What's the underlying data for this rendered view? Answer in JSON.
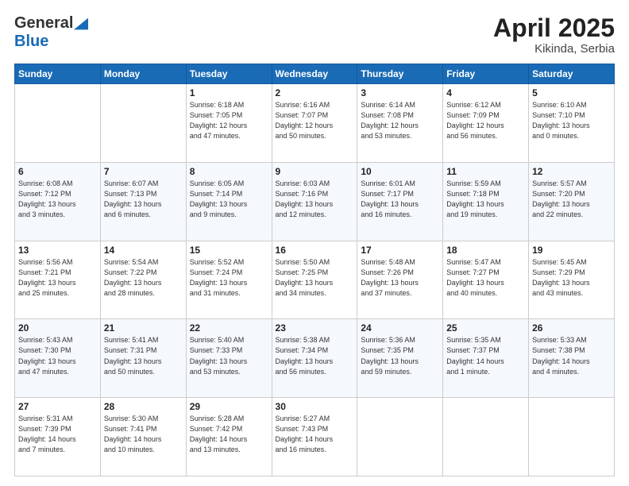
{
  "logo": {
    "general": "General",
    "blue": "Blue"
  },
  "title": "April 2025",
  "location": "Kikinda, Serbia",
  "days_of_week": [
    "Sunday",
    "Monday",
    "Tuesday",
    "Wednesday",
    "Thursday",
    "Friday",
    "Saturday"
  ],
  "weeks": [
    [
      {
        "day": "",
        "info": ""
      },
      {
        "day": "",
        "info": ""
      },
      {
        "day": "1",
        "info": "Sunrise: 6:18 AM\nSunset: 7:05 PM\nDaylight: 12 hours\nand 47 minutes."
      },
      {
        "day": "2",
        "info": "Sunrise: 6:16 AM\nSunset: 7:07 PM\nDaylight: 12 hours\nand 50 minutes."
      },
      {
        "day": "3",
        "info": "Sunrise: 6:14 AM\nSunset: 7:08 PM\nDaylight: 12 hours\nand 53 minutes."
      },
      {
        "day": "4",
        "info": "Sunrise: 6:12 AM\nSunset: 7:09 PM\nDaylight: 12 hours\nand 56 minutes."
      },
      {
        "day": "5",
        "info": "Sunrise: 6:10 AM\nSunset: 7:10 PM\nDaylight: 13 hours\nand 0 minutes."
      }
    ],
    [
      {
        "day": "6",
        "info": "Sunrise: 6:08 AM\nSunset: 7:12 PM\nDaylight: 13 hours\nand 3 minutes."
      },
      {
        "day": "7",
        "info": "Sunrise: 6:07 AM\nSunset: 7:13 PM\nDaylight: 13 hours\nand 6 minutes."
      },
      {
        "day": "8",
        "info": "Sunrise: 6:05 AM\nSunset: 7:14 PM\nDaylight: 13 hours\nand 9 minutes."
      },
      {
        "day": "9",
        "info": "Sunrise: 6:03 AM\nSunset: 7:16 PM\nDaylight: 13 hours\nand 12 minutes."
      },
      {
        "day": "10",
        "info": "Sunrise: 6:01 AM\nSunset: 7:17 PM\nDaylight: 13 hours\nand 16 minutes."
      },
      {
        "day": "11",
        "info": "Sunrise: 5:59 AM\nSunset: 7:18 PM\nDaylight: 13 hours\nand 19 minutes."
      },
      {
        "day": "12",
        "info": "Sunrise: 5:57 AM\nSunset: 7:20 PM\nDaylight: 13 hours\nand 22 minutes."
      }
    ],
    [
      {
        "day": "13",
        "info": "Sunrise: 5:56 AM\nSunset: 7:21 PM\nDaylight: 13 hours\nand 25 minutes."
      },
      {
        "day": "14",
        "info": "Sunrise: 5:54 AM\nSunset: 7:22 PM\nDaylight: 13 hours\nand 28 minutes."
      },
      {
        "day": "15",
        "info": "Sunrise: 5:52 AM\nSunset: 7:24 PM\nDaylight: 13 hours\nand 31 minutes."
      },
      {
        "day": "16",
        "info": "Sunrise: 5:50 AM\nSunset: 7:25 PM\nDaylight: 13 hours\nand 34 minutes."
      },
      {
        "day": "17",
        "info": "Sunrise: 5:48 AM\nSunset: 7:26 PM\nDaylight: 13 hours\nand 37 minutes."
      },
      {
        "day": "18",
        "info": "Sunrise: 5:47 AM\nSunset: 7:27 PM\nDaylight: 13 hours\nand 40 minutes."
      },
      {
        "day": "19",
        "info": "Sunrise: 5:45 AM\nSunset: 7:29 PM\nDaylight: 13 hours\nand 43 minutes."
      }
    ],
    [
      {
        "day": "20",
        "info": "Sunrise: 5:43 AM\nSunset: 7:30 PM\nDaylight: 13 hours\nand 47 minutes."
      },
      {
        "day": "21",
        "info": "Sunrise: 5:41 AM\nSunset: 7:31 PM\nDaylight: 13 hours\nand 50 minutes."
      },
      {
        "day": "22",
        "info": "Sunrise: 5:40 AM\nSunset: 7:33 PM\nDaylight: 13 hours\nand 53 minutes."
      },
      {
        "day": "23",
        "info": "Sunrise: 5:38 AM\nSunset: 7:34 PM\nDaylight: 13 hours\nand 56 minutes."
      },
      {
        "day": "24",
        "info": "Sunrise: 5:36 AM\nSunset: 7:35 PM\nDaylight: 13 hours\nand 59 minutes."
      },
      {
        "day": "25",
        "info": "Sunrise: 5:35 AM\nSunset: 7:37 PM\nDaylight: 14 hours\nand 1 minute."
      },
      {
        "day": "26",
        "info": "Sunrise: 5:33 AM\nSunset: 7:38 PM\nDaylight: 14 hours\nand 4 minutes."
      }
    ],
    [
      {
        "day": "27",
        "info": "Sunrise: 5:31 AM\nSunset: 7:39 PM\nDaylight: 14 hours\nand 7 minutes."
      },
      {
        "day": "28",
        "info": "Sunrise: 5:30 AM\nSunset: 7:41 PM\nDaylight: 14 hours\nand 10 minutes."
      },
      {
        "day": "29",
        "info": "Sunrise: 5:28 AM\nSunset: 7:42 PM\nDaylight: 14 hours\nand 13 minutes."
      },
      {
        "day": "30",
        "info": "Sunrise: 5:27 AM\nSunset: 7:43 PM\nDaylight: 14 hours\nand 16 minutes."
      },
      {
        "day": "",
        "info": ""
      },
      {
        "day": "",
        "info": ""
      },
      {
        "day": "",
        "info": ""
      }
    ]
  ]
}
